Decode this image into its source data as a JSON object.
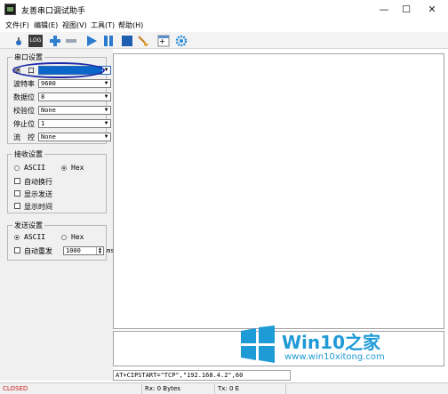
{
  "window": {
    "title": "友善串口调试助手",
    "minimize": "—",
    "maximize": "☐",
    "close": "✕"
  },
  "menu": [
    "文件(F)",
    "编辑(E)",
    "视图(V)",
    "工具(T)",
    "帮助(H)"
  ],
  "toolbar": {
    "log_label": "LOG"
  },
  "serial_settings": {
    "title": "串口设置",
    "port": {
      "label": "端　口",
      "value": ""
    },
    "baud": {
      "label": "波特率",
      "value": "9600"
    },
    "data_bits": {
      "label": "数据位",
      "value": "8"
    },
    "parity": {
      "label": "校验位",
      "value": "None"
    },
    "stop_bits": {
      "label": "停止位",
      "value": "1"
    },
    "flow": {
      "label": "流　控",
      "value": "None"
    }
  },
  "receive_settings": {
    "title": "接收设置",
    "ascii": "ASCII",
    "hex": "Hex",
    "selected_mode": "Hex",
    "auto_newline": "自动换行",
    "show_send": "显示发送",
    "show_time": "显示时间"
  },
  "send_settings": {
    "title": "发送设置",
    "ascii": "ASCII",
    "hex": "Hex",
    "selected_mode": "ASCII",
    "auto_resend": "自动重发",
    "interval": "1000",
    "interval_unit": "ms"
  },
  "command": "AT+CIPSTART=\"TCP\",\"192.168.4.2\",60",
  "status": {
    "port_state": "CLOSED",
    "rx": "Rx: 0 Bytes",
    "tx": "Tx: 0 E"
  },
  "watermark": {
    "brand": "Win10",
    "brand_suffix": "之家",
    "url": "www.win10xitong.com"
  },
  "colors": {
    "accent": "#0a66c8",
    "closed": "#d02020",
    "watermark": "#1e9ad6"
  }
}
